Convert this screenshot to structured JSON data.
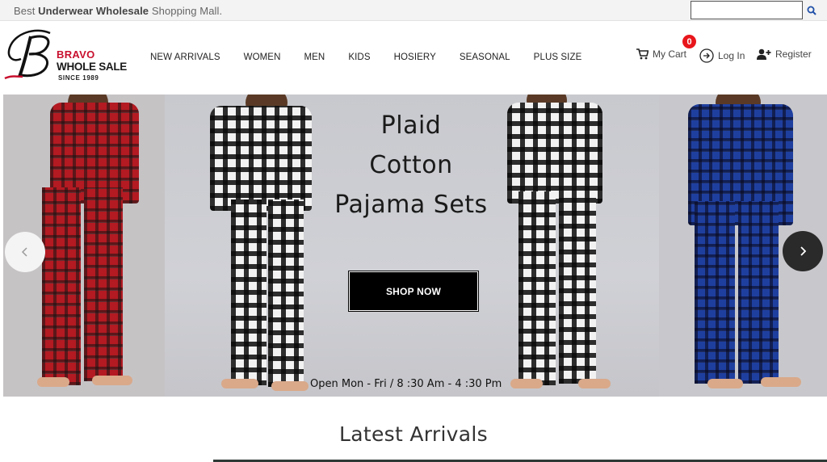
{
  "topbar": {
    "tagline_pre": "Best ",
    "tagline_bold": "Underwear Wholesale",
    "tagline_post": " Shopping Mall.",
    "search_placeholder": ""
  },
  "logo": {
    "monogram": "B",
    "line1": "BRAVO",
    "line2": "WHOLE SALE",
    "line3": "SINCE  1989"
  },
  "nav": {
    "items": [
      "NEW ARRIVALS",
      "WOMEN",
      "MEN",
      "KIDS",
      "HOSIERY",
      "SEASONAL",
      "PLUS SIZE"
    ]
  },
  "account": {
    "cart_label": "My Cart",
    "cart_count": "0",
    "login_label": "Log In",
    "register_label": "Register"
  },
  "banner": {
    "headline": [
      "Plaid",
      "Cotton",
      "Pajama Sets"
    ],
    "cta_label": "SHOP NOW",
    "hours": "Open Mon - Fri / 8 :30 Am - 4 :30 Pm",
    "prev_icon": "chevron-left-icon",
    "next_icon": "chevron-right-icon"
  },
  "section": {
    "title": "Latest Arrivals"
  },
  "colors": {
    "brand_red": "#c8102e",
    "badge_red": "#e8161b",
    "cta_bg": "#000000",
    "search_icon": "#1e4fa8"
  }
}
